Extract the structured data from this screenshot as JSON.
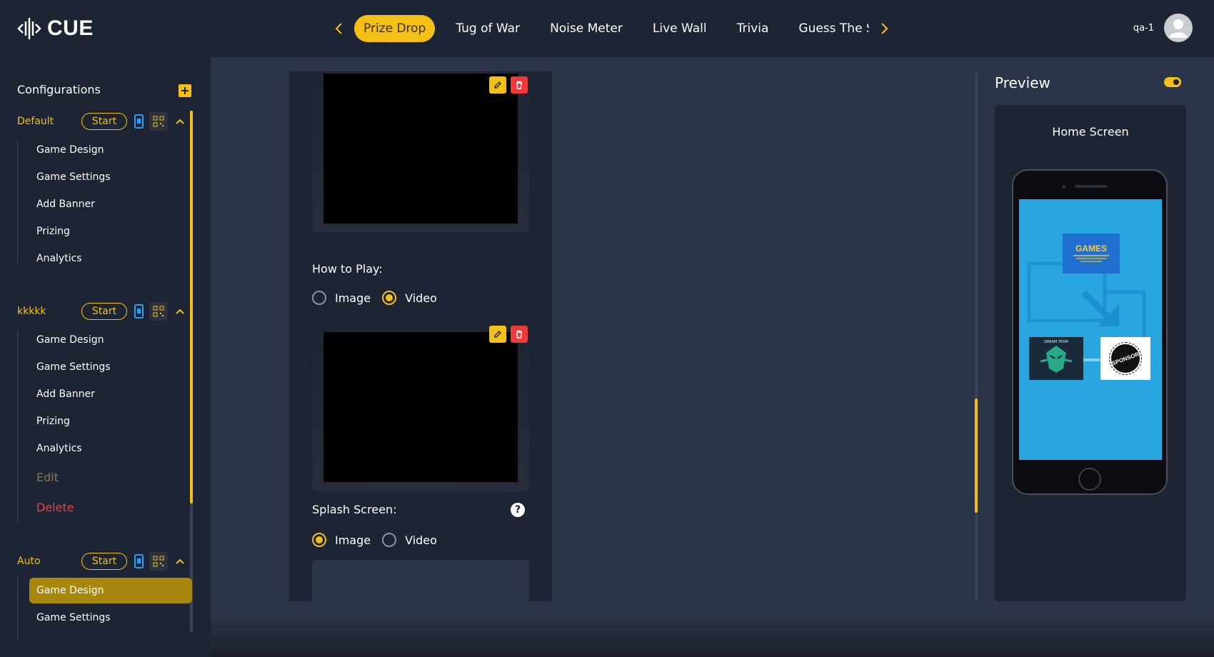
{
  "app": {
    "logo_text": "CUE"
  },
  "tabs": [
    {
      "label": "Prize Drop",
      "active": true
    },
    {
      "label": "Tug of War",
      "active": false
    },
    {
      "label": "Noise Meter",
      "active": false
    },
    {
      "label": "Live Wall",
      "active": false
    },
    {
      "label": "Trivia",
      "active": false
    },
    {
      "label": "Guess The Sc",
      "active": false
    }
  ],
  "user": {
    "name": "qa-1"
  },
  "sidebar": {
    "title": "Configurations",
    "groups": [
      {
        "name": "Default",
        "start_label": "Start",
        "items": [
          "Game Design",
          "Game Settings",
          "Add Banner",
          "Prizing",
          "Analytics"
        ]
      },
      {
        "name": "kkkkk",
        "start_label": "Start",
        "items": [
          "Game Design",
          "Game Settings",
          "Add Banner",
          "Prizing",
          "Analytics"
        ],
        "edit_label": "Edit",
        "delete_label": "Delete"
      },
      {
        "name": "Auto",
        "start_label": "Start",
        "items": [
          "Game Design",
          "Game Settings"
        ],
        "active_item": "Game Design"
      }
    ]
  },
  "form": {
    "how_to_play_label": "How to Play:",
    "how_to_play_options": [
      "Image",
      "Video"
    ],
    "how_to_play_selected": "Video",
    "splash_label": "Splash Screen:",
    "splash_options": [
      "Image",
      "Video"
    ],
    "splash_selected": "Image",
    "help_glyph": "?"
  },
  "preview": {
    "title": "Preview",
    "toggle_on": true,
    "screen_label": "Home Screen",
    "screen_logo_text": "GAMES",
    "screen_left_text": "DREAM TEAM",
    "screen_sponsor_text": "SPONSOR"
  },
  "colors": {
    "accent": "#f5c016",
    "danger": "#ee3a3a",
    "background": "#1d2433",
    "main_bg": "#2c3547",
    "phone_screen": "#29a6e0"
  }
}
